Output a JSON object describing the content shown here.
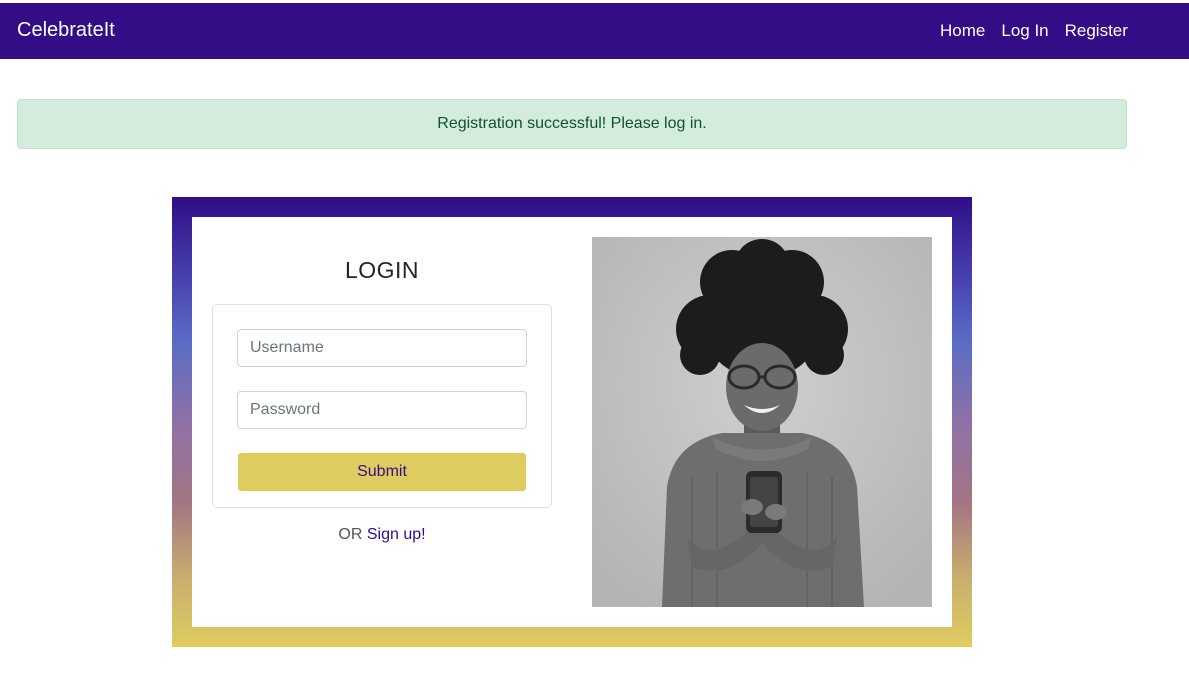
{
  "navbar": {
    "brand": "CelebrateIt",
    "links": [
      "Home",
      "Log In",
      "Register"
    ]
  },
  "alert": {
    "message": "Registration successful! Please log in."
  },
  "login": {
    "title": "LOGIN",
    "username_placeholder": "Username",
    "password_placeholder": "Password",
    "submit_label": "Submit",
    "or_text": "OR",
    "signup_label": "Sign up!"
  },
  "colors": {
    "navbar_bg": "#320d86",
    "accent_yellow": "#dfcc5f",
    "alert_bg": "#d4ecdc",
    "alert_text": "#0f5132"
  }
}
